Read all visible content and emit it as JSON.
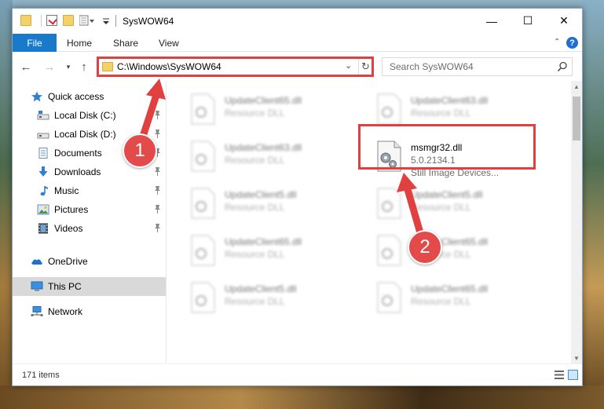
{
  "window": {
    "title": "SysWOW64",
    "controls": {
      "minimize": "—",
      "maximize": "☐",
      "close": "✕"
    }
  },
  "ribbon": {
    "tabs": [
      {
        "label": "File"
      },
      {
        "label": "Home"
      },
      {
        "label": "Share"
      },
      {
        "label": "View"
      }
    ],
    "help": "?"
  },
  "address": {
    "path": "C:\\Windows\\SysWOW64",
    "search_placeholder": "Search SysWOW64"
  },
  "nav": {
    "quick_access": "Quick access",
    "items": [
      {
        "label": "Local Disk (C:)",
        "icon": "drive-icon"
      },
      {
        "label": "Local Disk (D:)",
        "icon": "drive-icon"
      },
      {
        "label": "Documents",
        "icon": "documents-icon"
      },
      {
        "label": "Downloads",
        "icon": "downloads-icon"
      },
      {
        "label": "Music",
        "icon": "music-icon"
      },
      {
        "label": "Pictures",
        "icon": "pictures-icon"
      },
      {
        "label": "Videos",
        "icon": "videos-icon"
      }
    ],
    "onedrive": "OneDrive",
    "this_pc": "This PC",
    "network": "Network"
  },
  "files": {
    "left": [
      {
        "name": "UpdateClient65.dll",
        "type": "Resource DLL"
      },
      {
        "name": "UpdateClient63.dll",
        "type": "Resource DLL"
      },
      {
        "name": "UpdateClient5.dll",
        "type": "Resource DLL"
      },
      {
        "name": "UpdateClient65.dll",
        "type": "Resource DLL"
      },
      {
        "name": "UpdateClient5.dll",
        "type": "Resource DLL"
      }
    ],
    "right": [
      {
        "name": "UpdateClient63.dll",
        "type": "Resource DLL"
      },
      {
        "name": "UpdateClient5.dll",
        "type": "Resource DLL"
      },
      {
        "name": "UpdateClient65.dll",
        "type": "Resource DLL"
      },
      {
        "name": "UpdateClient65.dll",
        "type": "Resource DLL"
      }
    ],
    "highlighted": {
      "name": "msmgr32.dll",
      "version": "5.0.2134.1",
      "description": "Still Image Devices..."
    }
  },
  "status": {
    "item_count": "171 items"
  },
  "annotations": {
    "badge_1": "1",
    "badge_2": "2",
    "color": "#e34a4a"
  },
  "colors": {
    "accent": "#1979ca",
    "highlight_red": "#e04040",
    "selection": "#cce8ff"
  }
}
